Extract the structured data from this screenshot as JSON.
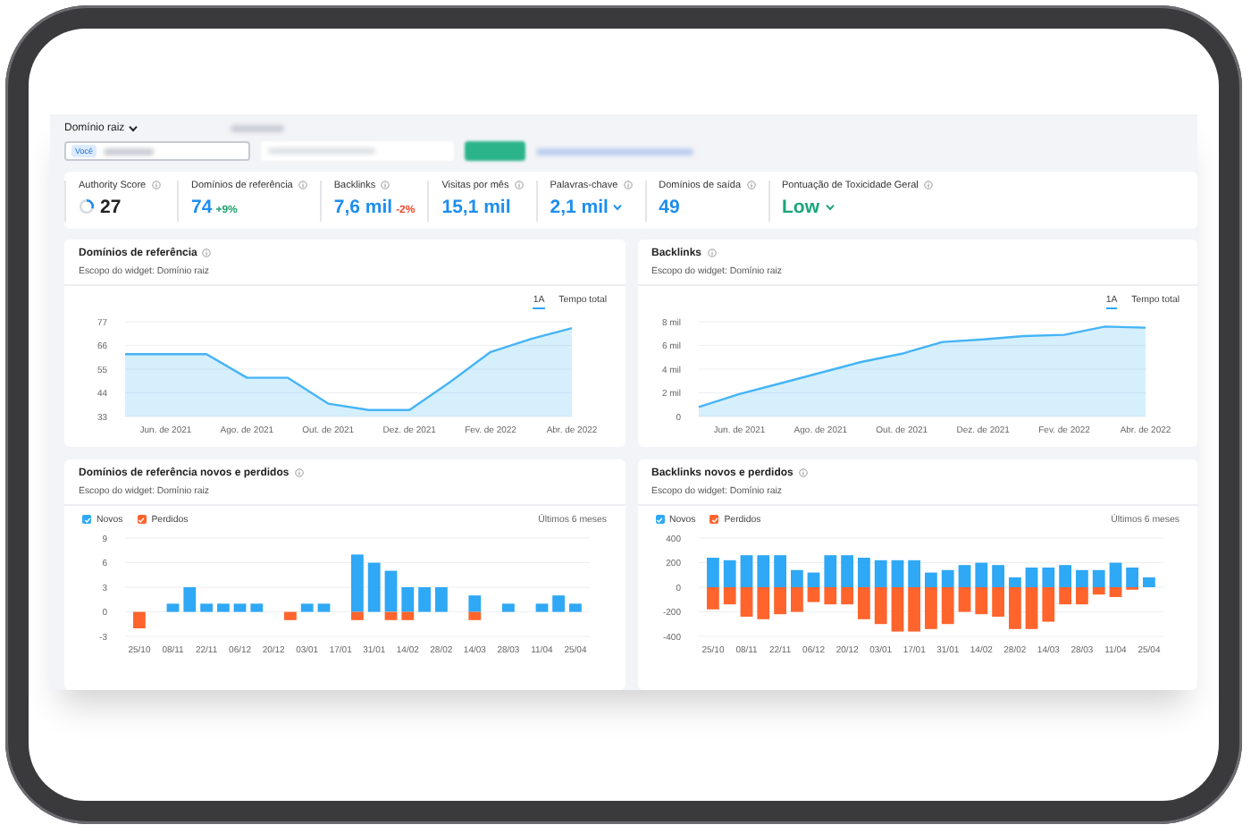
{
  "toolbar": {
    "scope_dropdown": "Domínio raiz",
    "search_field": {
      "badge": "Você"
    }
  },
  "metrics": [
    {
      "kind": "score",
      "label": "Authority Score",
      "value": "27"
    },
    {
      "kind": "number",
      "label": "Domínios de referência",
      "value": "74",
      "change": "+9%",
      "color": "#23a16f"
    },
    {
      "kind": "number",
      "label": "Backlinks",
      "value": "7,6 mil",
      "change": "-2%",
      "color": "#f1472b"
    },
    {
      "kind": "number",
      "label": "Visitas por mês",
      "value": "15,1 mil"
    },
    {
      "kind": "dropdown",
      "label": "Palavras-chave",
      "value": "2,1 mil"
    },
    {
      "kind": "number",
      "label": "Domínios de saída",
      "value": "49"
    },
    {
      "kind": "rating",
      "label": "Pontuação de Toxicidade Geral",
      "value": "Low"
    }
  ],
  "widgets": [
    {
      "title": "Domínios de referência",
      "subtitle": "Escopo do widget: Domínio raiz",
      "periods": [
        {
          "label": "1A",
          "selected": true
        },
        {
          "label": "Tempo total",
          "selected": false
        }
      ],
      "chart_data": {
        "type": "area",
        "categories": [
          null,
          "Jun. de 2021",
          null,
          "Ago. de 2021",
          null,
          "Out. de 2021",
          null,
          "Dez. de 2021",
          null,
          "Fev. de 2022",
          null,
          "Abr. de 2022"
        ],
        "series": [
          {
            "color": "#45b4f6",
            "values": [
              62,
              62,
              62,
              51,
              51,
              39,
              36,
              36,
              49,
              63,
              69,
              74
            ]
          }
        ],
        "ylim": [
          33,
          77
        ],
        "yticks": [
          33,
          44,
          55,
          66,
          77
        ],
        "grid": true
      }
    },
    {
      "title": "Backlinks",
      "subtitle": "Escopo do widget: Domínio raiz",
      "periods": [
        {
          "label": "1A",
          "selected": true
        },
        {
          "label": "Tempo total",
          "selected": false
        }
      ],
      "chart_data": {
        "type": "area",
        "categories": [
          null,
          "Jun. de 2021",
          null,
          "Ago. de 2021",
          null,
          "Out. de 2021",
          null,
          "Dez. de 2021",
          null,
          "Fev. de 2022",
          null,
          "Abr. de 2022"
        ],
        "series": [
          {
            "color": "#45b4f6",
            "values": [
              0.8,
              1.9,
              2.8,
              3.7,
              4.6,
              5.3,
              6.3,
              6.5,
              6.8,
              6.9,
              7.6,
              7.5
            ]
          }
        ],
        "ylim": [
          0,
          8
        ],
        "yticks": [
          0,
          {
            "value": 2,
            "label": "2 mil"
          },
          {
            "value": 4,
            "label": "4 mil"
          },
          {
            "value": 6,
            "label": "6 mil"
          },
          {
            "value": 8,
            "label": "8 mil"
          }
        ],
        "grid": true
      }
    },
    {
      "title": "Domínios de referência novos e perdidos",
      "subtitle": "Escopo do widget: Domínio raiz",
      "legend": [
        {
          "checked": true
        },
        {
          "checked": true
        }
      ],
      "range_label": "Últimos 6 meses",
      "chart_data": {
        "type": "bar",
        "stacked": true,
        "categories": [
          "25/10",
          null,
          "08/11",
          null,
          "22/11",
          null,
          "06/12",
          null,
          "20/12",
          null,
          "03/01",
          null,
          "17/01",
          null,
          "31/01",
          null,
          "14/02",
          null,
          "28/02",
          null,
          "14/03",
          null,
          "28/03",
          null,
          "11/04",
          null,
          "25/04"
        ],
        "series": [
          {
            "name": "Novos",
            "color": "#2fa8f5",
            "values": [
              0,
              0,
              1,
              3,
              1,
              1,
              1,
              1,
              0,
              0,
              1,
              1,
              0,
              7,
              6,
              5,
              3,
              3,
              3,
              0,
              2,
              0,
              1,
              0,
              1,
              2,
              1
            ]
          },
          {
            "name": "Perdidos",
            "color": "#ff642d",
            "values": [
              -2,
              0,
              0,
              0,
              0,
              0,
              0,
              0,
              0,
              -1,
              0,
              0,
              0,
              -1,
              0,
              -1,
              -1,
              0,
              0,
              0,
              -1,
              0,
              0,
              0,
              0,
              0,
              0
            ]
          }
        ],
        "ylim": [
          -3,
          9
        ],
        "yticks": [
          -3,
          0,
          3,
          6,
          9
        ],
        "grid": true
      }
    },
    {
      "title": "Backlinks novos e perdidos",
      "subtitle": "Escopo do widget: Domínio raiz",
      "legend": [
        {
          "checked": true
        },
        {
          "checked": true
        }
      ],
      "range_label": "Últimos 6 meses",
      "chart_data": {
        "type": "bar",
        "stacked": true,
        "categories": [
          "25/10",
          null,
          "08/11",
          null,
          "22/11",
          null,
          "06/12",
          null,
          "20/12",
          null,
          "03/01",
          null,
          "17/01",
          null,
          "31/01",
          null,
          "14/02",
          null,
          "28/02",
          null,
          "14/03",
          null,
          "28/03",
          null,
          "11/04",
          null,
          "25/04"
        ],
        "series": [
          {
            "name": "Novos",
            "color": "#2fa8f5",
            "values": [
              240,
              220,
              260,
              260,
              260,
              140,
              120,
              260,
              260,
              240,
              220,
              220,
              220,
              120,
              140,
              180,
              200,
              180,
              80,
              160,
              160,
              180,
              140,
              140,
              200,
              160,
              80
            ]
          },
          {
            "name": "Perdidos",
            "color": "#ff642d",
            "values": [
              -180,
              -140,
              -240,
              -260,
              -220,
              -200,
              -120,
              -140,
              -140,
              -260,
              -300,
              -360,
              -360,
              -340,
              -300,
              -200,
              -220,
              -240,
              -340,
              -340,
              -280,
              -140,
              -140,
              -60,
              -80,
              -20,
              0
            ]
          }
        ],
        "ylim": [
          -400,
          400
        ],
        "yticks": [
          -400,
          -200,
          0,
          200,
          400
        ],
        "grid": true
      }
    }
  ]
}
